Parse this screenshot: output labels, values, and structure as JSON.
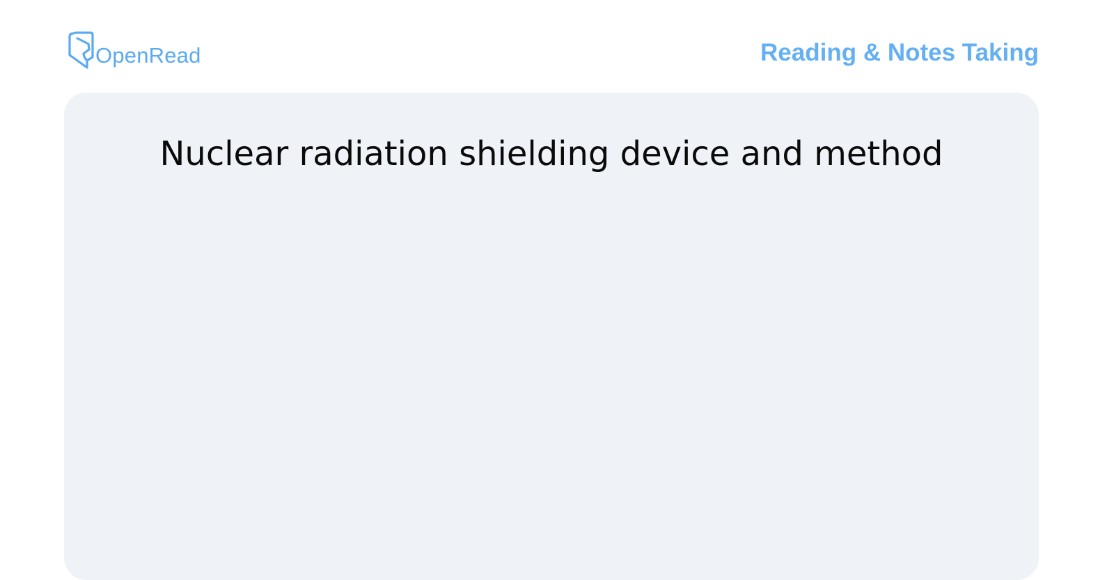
{
  "header": {
    "logo": {
      "text": "OpenRead",
      "icon": "openread-logo-icon",
      "color": "#5aaaf0"
    },
    "tagline": "Reading & Notes Taking",
    "tagline_color": "#64b0f2"
  },
  "document": {
    "title": "Nuclear radiation shielding device and method"
  },
  "colors": {
    "card_background": "#eff3f7",
    "page_background": "#ffffff",
    "title_text": "#0a0a0a"
  }
}
